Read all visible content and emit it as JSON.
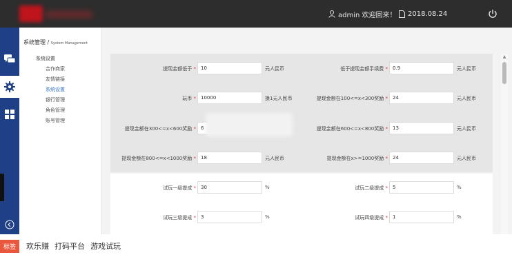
{
  "header": {
    "greeting": "admin 欢迎回来！",
    "date": "2018.08.24"
  },
  "rail": {
    "icons": [
      "chat-icon",
      "gear-icon",
      "grid-icon",
      "back-arrow-icon"
    ]
  },
  "sidebar": {
    "title_zh": "系统管理",
    "title_sep": " / ",
    "title_en": "System Management",
    "group": "系统设置",
    "items": [
      {
        "label": "合作商家"
      },
      {
        "label": "友情链接"
      },
      {
        "label": "系统设置"
      },
      {
        "label": "银行管理"
      },
      {
        "label": "角色管理"
      },
      {
        "label": "账号管理"
      }
    ]
  },
  "form": {
    "required_mark": "*",
    "fields": [
      {
        "label": "提现金额低于",
        "value": "10",
        "unit": "元人民币"
      },
      {
        "label": "低于提现金额手续费",
        "value": "0.9",
        "unit": "元人民币"
      },
      {
        "label": "玩币",
        "value": "10000",
        "unit": "换1元人民币"
      },
      {
        "label": "提现金额在100<=x<300奖励",
        "value": "24",
        "unit": "元人民币"
      },
      {
        "label": "提现金额在300<=x<600奖励",
        "value": "6",
        "unit": ""
      },
      {
        "label": "提现金额在600<=x<800奖励",
        "value": "13",
        "unit": "元人民币"
      },
      {
        "label": "提现金额在800<=x<1000奖励",
        "value": "18",
        "unit": "元人民币"
      },
      {
        "label": "提现金额在x>=1000奖励",
        "value": "24",
        "unit": "元人民币"
      },
      {
        "label": "试玩一级提成",
        "value": "30",
        "unit": "%"
      },
      {
        "label": "试玩二级提成",
        "value": "5",
        "unit": "%"
      },
      {
        "label": "试玩三级提成",
        "value": "3",
        "unit": "%"
      },
      {
        "label": "试玩四级提成",
        "value": "1",
        "unit": "%"
      }
    ]
  },
  "tags": {
    "badge": "标签",
    "items": [
      "欢乐赚",
      "打码平台",
      "游戏试玩"
    ]
  },
  "colors": {
    "topbar": "#2d2d2d",
    "rail": "#1f3f86",
    "accent": "#3a74c8",
    "required": "#dd3333",
    "tag_badge": "#e9573f"
  }
}
